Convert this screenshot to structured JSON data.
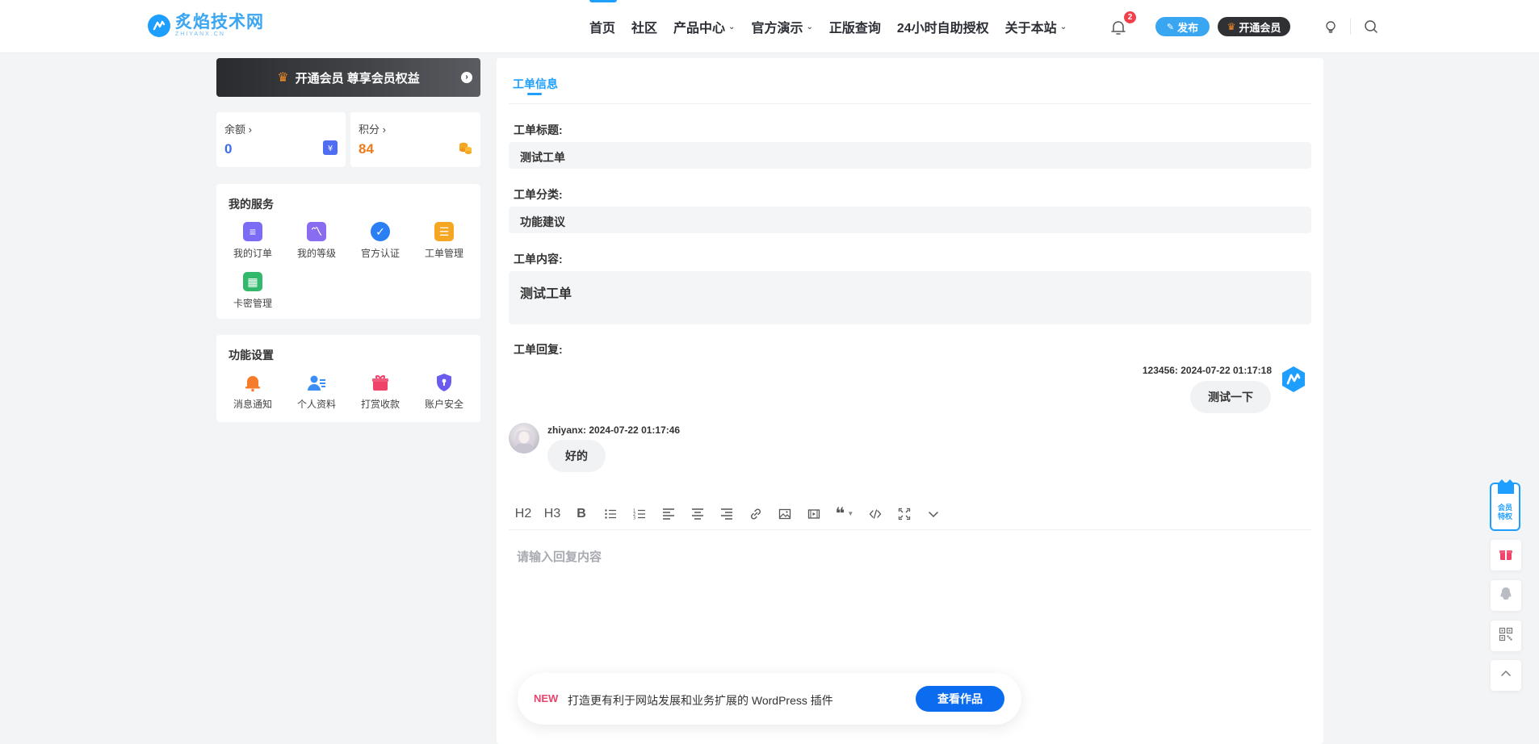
{
  "header": {
    "logo": {
      "name": "炙焰技术网",
      "sub": "ZHIYANX.CN"
    },
    "nav": [
      {
        "label": "首页",
        "has_dropdown": false
      },
      {
        "label": "社区",
        "has_dropdown": false
      },
      {
        "label": "产品中心",
        "has_dropdown": true
      },
      {
        "label": "官方演示",
        "has_dropdown": true
      },
      {
        "label": "正版查询",
        "has_dropdown": false
      },
      {
        "label": "24小时自助授权",
        "has_dropdown": false
      },
      {
        "label": "关于本站",
        "has_dropdown": true
      }
    ],
    "notification_count": "2",
    "publish_label": "发布",
    "vip_label": "开通会员"
  },
  "sidebar": {
    "vip_banner": "开通会员 尊享会员权益",
    "balance": {
      "label": "余额",
      "value": "0"
    },
    "points": {
      "label": "积分",
      "value": "84"
    },
    "services": {
      "title": "我的服务",
      "items": [
        {
          "label": "我的订单",
          "icon": "order-icon",
          "color": "#7b6cf6"
        },
        {
          "label": "我的等级",
          "icon": "level-icon",
          "color": "#8a6cf0"
        },
        {
          "label": "官方认证",
          "icon": "verified-icon",
          "color": "#2a7ff5"
        },
        {
          "label": "工单管理",
          "icon": "ticket-icon",
          "color": "#f5a623"
        },
        {
          "label": "卡密管理",
          "icon": "card-key-icon",
          "color": "#34b86b"
        }
      ]
    },
    "settings": {
      "title": "功能设置",
      "items": [
        {
          "label": "消息通知",
          "icon": "bell-icon",
          "color": "#f57c2a"
        },
        {
          "label": "个人资料",
          "icon": "profile-icon",
          "color": "#3a8ef5"
        },
        {
          "label": "打赏收款",
          "icon": "gift-icon",
          "color": "#f0436a"
        },
        {
          "label": "账户安全",
          "icon": "shield-icon",
          "color": "#6b5cf0"
        }
      ]
    }
  },
  "ticket": {
    "tab": "工单信息",
    "title_label": "工单标题:",
    "title_value": "测试工单",
    "category_label": "工单分类:",
    "category_value": "功能建议",
    "content_label": "工单内容:",
    "content_value": "测试工单",
    "reply_label": "工单回复:",
    "replies": [
      {
        "meta": "123456: 2024-07-22 01:17:18",
        "text": "测试一下",
        "side": "right"
      },
      {
        "meta": "zhiyanx: 2024-07-22 01:17:46",
        "text": "好的",
        "side": "left"
      }
    ]
  },
  "editor": {
    "toolbar": {
      "h2": "H2",
      "h3": "H3",
      "bold": "B"
    },
    "placeholder": "请输入回复内容"
  },
  "promo": {
    "badge": "NEW",
    "text": "打造更有利于网站发展和业务扩展的 WordPress 插件",
    "button": "查看作品"
  },
  "float": {
    "vip_text_1": "会员",
    "vip_text_2": "特权"
  },
  "colors": {
    "accent": "#1e9fff",
    "balance": "#3b6cf0",
    "points": "#f07a1a"
  }
}
